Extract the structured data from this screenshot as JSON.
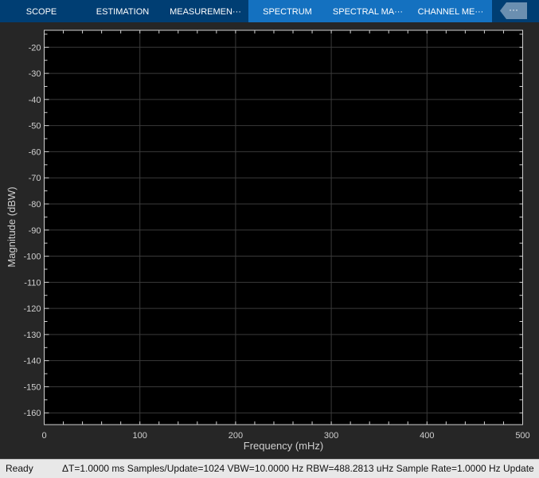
{
  "tabs": [
    {
      "label": "SCOPE",
      "highlighted": false
    },
    {
      "label": "ESTIMATION",
      "highlighted": false
    },
    {
      "label": "MEASUREMEN···",
      "highlighted": false
    },
    {
      "label": "SPECTRUM",
      "highlighted": true
    },
    {
      "label": "SPECTRAL MA···",
      "highlighted": true
    },
    {
      "label": "CHANNEL ME···",
      "highlighted": true
    }
  ],
  "more_label": "···",
  "status": {
    "state": "Ready",
    "info": "ΔT=1.0000 ms  Samples/Update=1024  VBW=10.0000 Hz  RBW=488.2813 uHz  Sample Rate=1.0000 Hz  Update"
  },
  "chart_data": {
    "type": "line",
    "series": [],
    "xlabel": "Frequency (mHz)",
    "ylabel": "Magnitude (dBW)",
    "xlim": [
      0,
      500
    ],
    "ylim": [
      -164.5,
      -13.5
    ],
    "xticks": [
      "0",
      "100",
      "200",
      "300",
      "400",
      "500"
    ],
    "yticks": [
      "-20",
      "-30",
      "-40",
      "-50",
      "-60",
      "-70",
      "-80",
      "-90",
      "-100",
      "-110",
      "-120",
      "-130",
      "-140",
      "-150",
      "-160"
    ],
    "grid": true,
    "colors": {
      "background": "#000000",
      "axes": "#d0d0d0",
      "grid": "#3a3a3a",
      "text": "#cfcfcf"
    }
  }
}
